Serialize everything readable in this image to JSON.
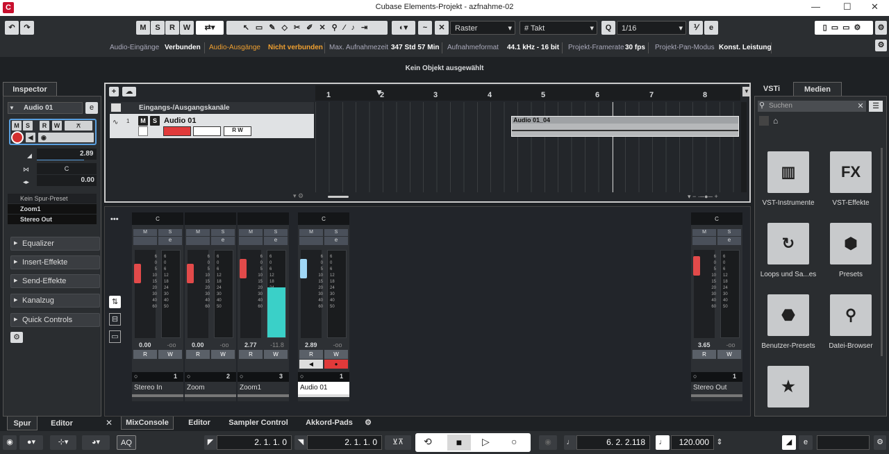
{
  "window": {
    "title": "Cubase Elements-Projekt - azfnahme-02"
  },
  "toolbar": {
    "buttons": [
      "M",
      "S",
      "R",
      "W"
    ],
    "snap": "Raster",
    "grid": "Takt",
    "quantize": "1/16"
  },
  "status": {
    "l1": "Audio-Eingänge",
    "v1": "Verbunden",
    "l2": "Audio-Ausgänge",
    "v2": "Nicht verbunden",
    "l3": "Max. Aufnahmezeit",
    "v3": "347 Std 57 Min",
    "l4": "Aufnahmeformat",
    "v4": "44.1 kHz - 16 bit",
    "l5": "Projekt-Framerate",
    "v5": "30 fps",
    "l6": "Projekt-Pan-Modus",
    "v6": "Konst. Leistung"
  },
  "info": {
    "text": "Kein Objekt ausgewählt"
  },
  "inspector": {
    "tab": "Inspector",
    "track": "Audio 01",
    "vol": "2.89",
    "pan": "C",
    "delay": "0.00",
    "preset": "Kein Spur-Preset",
    "input": "Zoom1",
    "output": "Stereo Out",
    "sections": [
      "Equalizer",
      "Insert-Effekte",
      "Send-Effekte",
      "Kanalzug",
      "Quick Controls"
    ],
    "bottom_tabs": [
      "Spur",
      "Editor"
    ]
  },
  "project": {
    "folder": "Eingangs-/Ausgangskanäle",
    "track": "Audio 01",
    "track_num": "1",
    "event": "Audio 01_04",
    "ruler": [
      "1",
      "2",
      "3",
      "4",
      "5",
      "6",
      "7",
      "8"
    ]
  },
  "mixer": {
    "channels": [
      {
        "name": "Stereo In",
        "vol": "0.00",
        "peak": "-oo",
        "num": "1",
        "pan": "C"
      },
      {
        "name": "Zoom",
        "vol": "0.00",
        "peak": "-oo",
        "num": "2",
        "pan": ""
      },
      {
        "name": "Zoom1",
        "vol": "2.77",
        "peak": "-11.8",
        "num": "3",
        "pan": ""
      },
      {
        "name": "Audio 01",
        "vol": "2.89",
        "peak": "-oo",
        "num": "1",
        "pan": "C"
      },
      {
        "name": "Stereo Out",
        "vol": "3.65",
        "peak": "-oo",
        "num": "1",
        "pan": "C"
      }
    ],
    "scale": [
      "6",
      "0",
      "6",
      "12",
      "18",
      "24",
      "30",
      "40",
      "50"
    ],
    "lscale": [
      "6",
      "0",
      "5",
      "10",
      "15",
      "20",
      "30",
      "40",
      "60"
    ],
    "tabs": [
      "MixConsole",
      "Editor",
      "Sampler Control",
      "Akkord-Pads"
    ]
  },
  "media": {
    "tabs": [
      "VSTi",
      "Medien"
    ],
    "search_placeholder": "Suchen",
    "tiles": [
      "VST-Instrumente",
      "VST-Effekte",
      "Loops und Sa...es",
      "Presets",
      "Benutzer-Presets",
      "Datei-Browser",
      ""
    ]
  },
  "transport": {
    "left": "2. 1. 1.   0",
    "right": "2. 1. 1.   0",
    "pos": "6.  2.  2.118",
    "tempo": "120.000",
    "aq": "AQ"
  }
}
